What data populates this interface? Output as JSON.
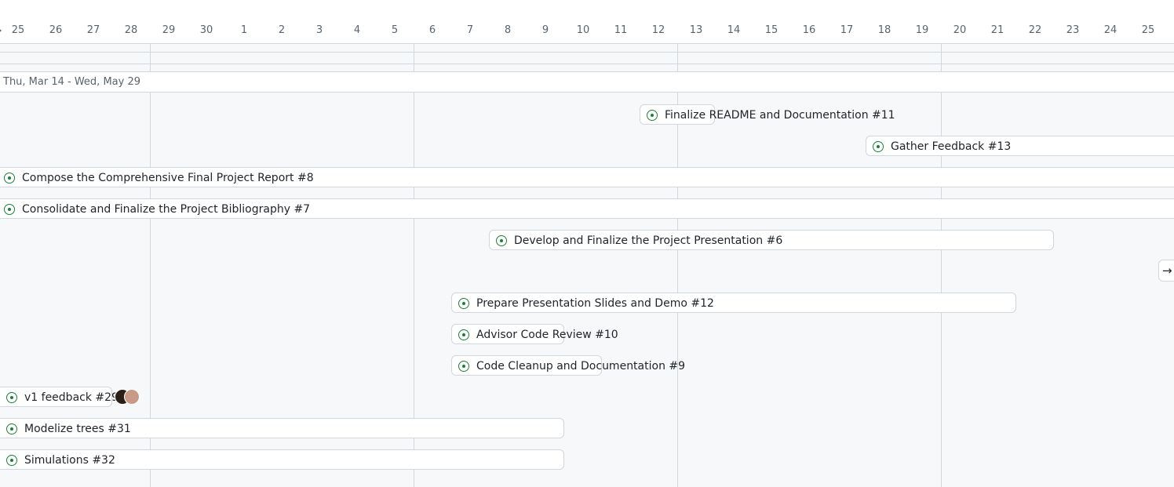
{
  "timeline": {
    "days": [
      "25",
      "26",
      "27",
      "28",
      "29",
      "30",
      "1",
      "2",
      "3",
      "4",
      "5",
      "6",
      "7",
      "8",
      "9",
      "10",
      "11",
      "12",
      "13",
      "14",
      "15",
      "16",
      "17",
      "18",
      "19",
      "20",
      "21",
      "22",
      "23",
      "24",
      "25"
    ],
    "iteration_label": "Thu, Mar 14 - Wed, May 29"
  },
  "items": [
    {
      "title": "Finalize README and Documentation #11"
    },
    {
      "title": "Gather Feedback #13"
    },
    {
      "title": "Compose the Comprehensive Final Project Report #8"
    },
    {
      "title": "Consolidate and Finalize the Project Bibliography #7"
    },
    {
      "title": "Develop and Finalize the Project Presentation #6"
    },
    {
      "title": "Prepare Presentation Slides and Demo #12"
    },
    {
      "title": "Advisor Code Review #10"
    },
    {
      "title": "Code Cleanup and Documentation #9"
    },
    {
      "title": "v1 feedback #29"
    },
    {
      "title": "Modelize trees #31"
    },
    {
      "title": "Simulations #32"
    }
  ],
  "colors": {
    "open_issue": "#1a7f37",
    "border": "#d0d7de",
    "muted_text": "#59636e"
  },
  "icons": {
    "issue_status": "issue-opened-icon",
    "scroll": "arrow-right-icon"
  }
}
